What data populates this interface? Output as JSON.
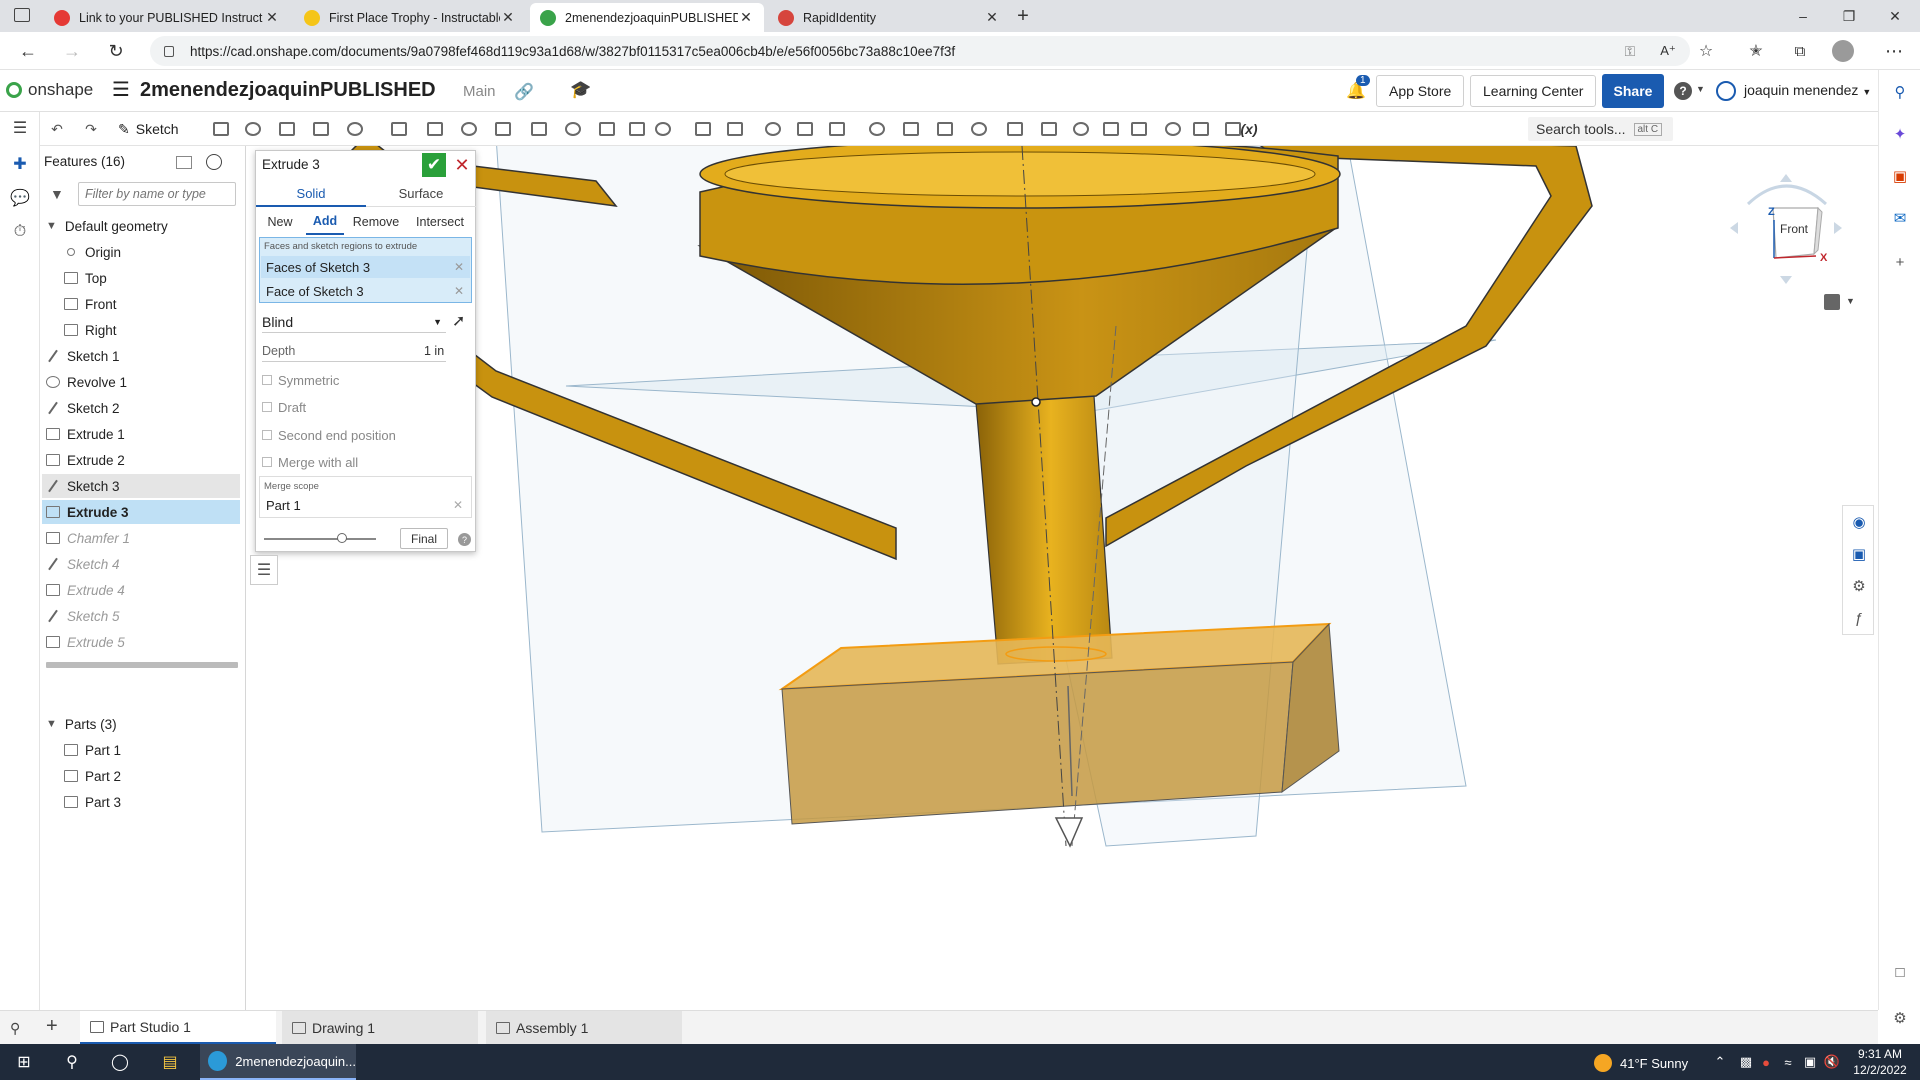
{
  "browser": {
    "tabs": [
      {
        "title": "Link to your PUBLISHED Instruct",
        "icon": "instructables-icon",
        "color": "#e53935"
      },
      {
        "title": "First Place Trophy - Instructables",
        "icon": "instructables-robot-icon",
        "color": "#f5c518"
      },
      {
        "title": "2menendezjoaquinPUBLISHED |",
        "icon": "onshape-icon",
        "color": "#3aa34a"
      },
      {
        "title": "RapidIdentity",
        "icon": "rapididentity-icon",
        "color": "#d6453d"
      }
    ],
    "url": "https://cad.onshape.com/documents/9a0798fef468d119c93a1d68/w/3827bf0115317c5ea006cb4b/e/e56f0056bc73a88c10ee7f3f"
  },
  "header": {
    "logo_text": "onshape",
    "document_name": "2menendezjoaquinPUBLISHED",
    "branch": "Main",
    "notification_count": "1",
    "app_store": "App Store",
    "learning_center": "Learning Center",
    "share": "Share",
    "help": "?",
    "user": "joaquin menendez"
  },
  "toolbar": {
    "sketch_label": "Sketch",
    "search_tools": "Search tools...",
    "search_shortcut": "alt C",
    "variable_label": "(x)"
  },
  "features": {
    "title": "Features (16)",
    "filter_placeholder": "Filter by name or type",
    "default_geometry": "Default geometry",
    "geometry_items": [
      "Origin",
      "Top",
      "Front",
      "Right"
    ],
    "items": [
      {
        "label": "Sketch 1",
        "kind": "sketch",
        "state": "normal"
      },
      {
        "label": "Revolve 1",
        "kind": "revolve",
        "state": "normal"
      },
      {
        "label": "Sketch 2",
        "kind": "sketch",
        "state": "normal"
      },
      {
        "label": "Extrude 1",
        "kind": "extrude",
        "state": "normal"
      },
      {
        "label": "Extrude 2",
        "kind": "extrude",
        "state": "normal"
      },
      {
        "label": "Sketch 3",
        "kind": "sketch",
        "state": "hover"
      },
      {
        "label": "Extrude 3",
        "kind": "extrude",
        "state": "selected"
      },
      {
        "label": "Chamfer 1",
        "kind": "chamfer",
        "state": "suppressed"
      },
      {
        "label": "Sketch 4",
        "kind": "sketch",
        "state": "suppressed"
      },
      {
        "label": "Extrude 4",
        "kind": "extrude",
        "state": "suppressed"
      },
      {
        "label": "Sketch 5",
        "kind": "sketch",
        "state": "suppressed"
      },
      {
        "label": "Extrude 5",
        "kind": "extrude",
        "state": "suppressed"
      }
    ],
    "parts_title": "Parts (3)",
    "parts": [
      "Part 1",
      "Part 2",
      "Part 3"
    ]
  },
  "dialog": {
    "title": "Extrude 3",
    "body_types": [
      "Solid",
      "Surface"
    ],
    "active_body_type": "Solid",
    "operations": [
      "New",
      "Add",
      "Remove",
      "Intersect"
    ],
    "active_operation": "Add",
    "faces_caption": "Faces and sketch regions to extrude",
    "faces": [
      "Faces of Sketch 3",
      "Face of Sketch 3"
    ],
    "end_type": "Blind",
    "depth_label": "Depth",
    "depth_value": "1 in",
    "checkboxes": [
      "Symmetric",
      "Draft",
      "Second end position",
      "Merge with all"
    ],
    "merge_scope_caption": "Merge scope",
    "merge_scope_value": "Part 1",
    "final_button": "Final",
    "slider_fraction": 0.7
  },
  "viewcube": {
    "face_label": "Front",
    "axis_x": "X",
    "axis_z": "Z"
  },
  "bottom_tabs": [
    {
      "label": "Part Studio 1",
      "active": true
    },
    {
      "label": "Drawing 1",
      "active": false
    },
    {
      "label": "Assembly 1",
      "active": false
    }
  ],
  "taskbar": {
    "app_label": "2menendezjoaquin...",
    "weather": "41°F  Sunny",
    "time": "9:31 AM",
    "date": "12/2/2022"
  },
  "colors": {
    "accent": "#1a5bb0",
    "ok": "#2aa03a",
    "cancel": "#c0262c",
    "trophy_gold": "#d9a21b",
    "selection": "#bfe0f5"
  }
}
